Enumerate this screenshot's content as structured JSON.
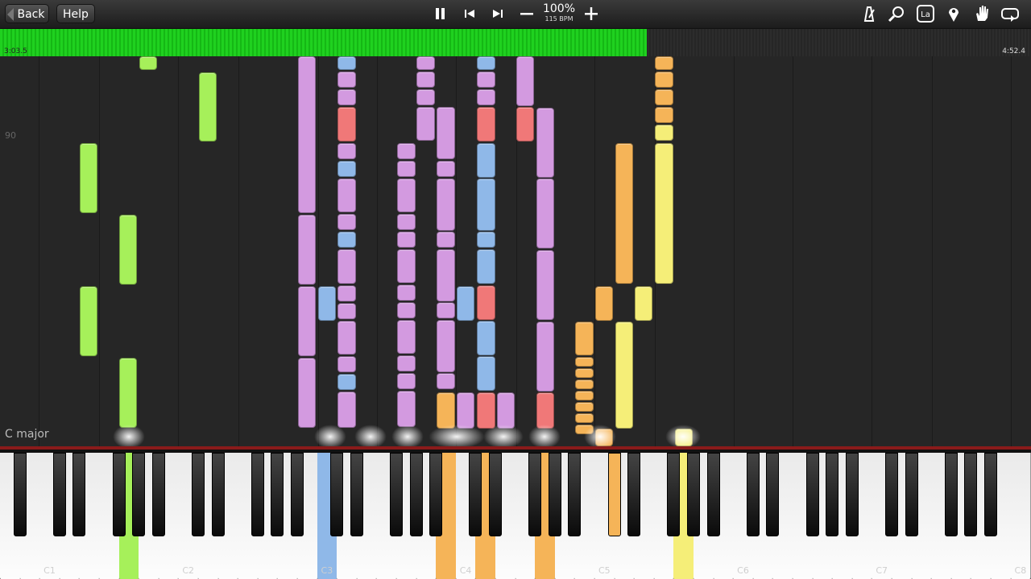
{
  "toolbar": {
    "back_label": "Back",
    "help_label": "Help",
    "tempo_percent": "100%",
    "tempo_bpm": "115 BPM",
    "pause_icon": "⏸",
    "prev_icon": "⏮",
    "next_icon": "⏭",
    "minus_icon": "−",
    "plus_icon": "+",
    "metronome_icon": "metronome",
    "zoom_icon": "🔍",
    "label_icon": "La",
    "location_icon": "📍",
    "hand_icon": "✋",
    "loop_icon": "⟲"
  },
  "progress": {
    "elapsed": "3:03.5",
    "total": "4:52.4",
    "fraction": 0.627,
    "fill_color": "#1fd11f"
  },
  "roll": {
    "measure_number": "90",
    "key_signature": "C major"
  },
  "keyboard": {
    "octave_labels": [
      "C1",
      "C2",
      "C3",
      "C4",
      "C5",
      "C6",
      "C7",
      "C8"
    ]
  },
  "colors": {
    "green": "#a6f05a",
    "purple": "#d39ae0",
    "blue": "#8fb8e8",
    "red": "#f07878",
    "orange": "#f5b458",
    "yellow": "#f5ee78",
    "toolbar_bg": "#2a2a2a",
    "roll_bg": "#262626"
  }
}
